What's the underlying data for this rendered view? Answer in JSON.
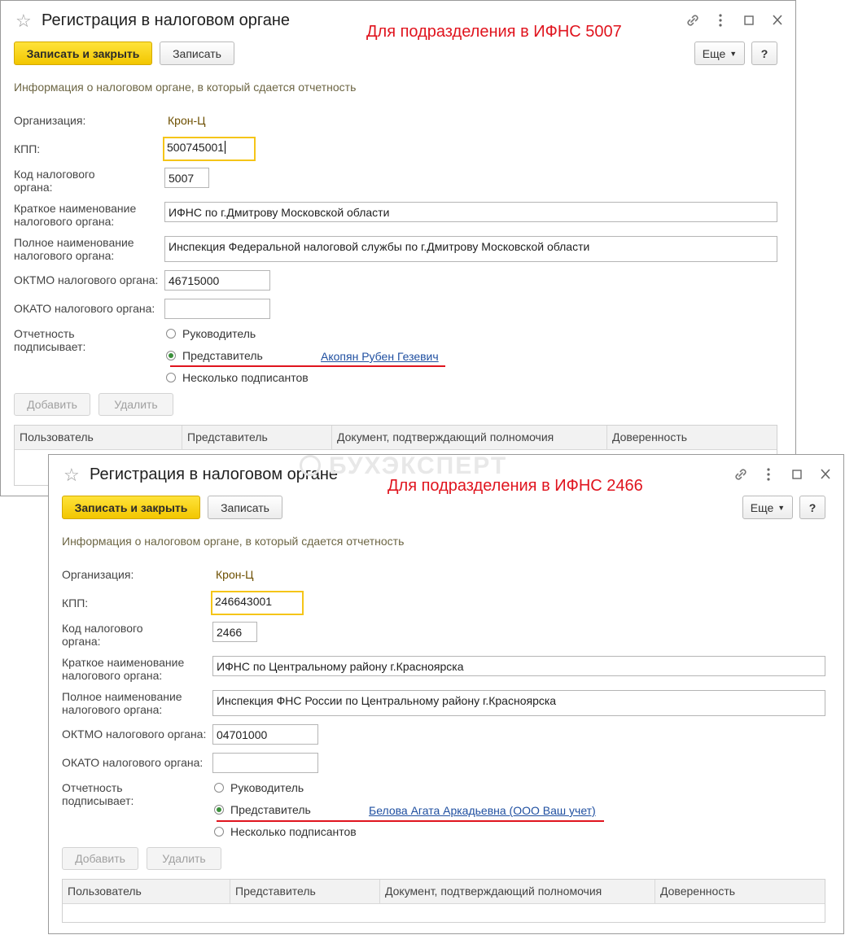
{
  "forms": [
    {
      "title": "Регистрация в налоговом органе",
      "annotation": "Для подразделения в ИФНС 5007",
      "buttons": {
        "save_close": "Записать и закрыть",
        "save": "Записать",
        "more": "Еще",
        "help": "?"
      },
      "hint": "Информация о налоговом органе, в который сдается отчетность",
      "labels": {
        "organization": "Организация:",
        "kpp": "КПП:",
        "code": "Код налогового органа:",
        "short_name": "Краткое наименование налогового органа:",
        "full_name": "Полное наименование налогового органа:",
        "oktmo": "ОКТМО налогового органа:",
        "okato": "ОКАТО налогового органа:",
        "signer": "Отчетность подписывает:"
      },
      "values": {
        "organization": "Крон-Ц",
        "kpp": "500745001",
        "code": "5007",
        "short_name": "ИФНС по г.Дмитрову Московской области",
        "full_name": "Инспекция Федеральной налоговой службы по г.Дмитрову Московской области",
        "oktmo": "46715000",
        "okato": ""
      },
      "signer_options": [
        "Руководитель",
        "Представитель",
        "Несколько подписантов"
      ],
      "signer_selected": "Представитель",
      "representative": "Акопян Рубен Гезевич",
      "table_buttons": {
        "add": "Добавить",
        "delete": "Удалить"
      },
      "table_columns": [
        "Пользователь",
        "Представитель",
        "Документ, подтверждающий полномочия",
        "Доверенность"
      ]
    },
    {
      "title": "Регистрация в налоговом органе",
      "annotation": "Для подразделения в ИФНС 2466",
      "buttons": {
        "save_close": "Записать и закрыть",
        "save": "Записать",
        "more": "Еще",
        "help": "?"
      },
      "hint": "Информация о налоговом органе, в который сдается отчетность",
      "labels": {
        "organization": "Организация:",
        "kpp": "КПП:",
        "code": "Код налогового органа:",
        "short_name": "Краткое наименование налогового органа:",
        "full_name": "Полное наименование налогового органа:",
        "oktmo": "ОКТМО налогового органа:",
        "okato": "ОКАТО налогового органа:",
        "signer": "Отчетность подписывает:"
      },
      "values": {
        "organization": "Крон-Ц",
        "kpp": "246643001",
        "code": "2466",
        "short_name": "ИФНС по Центральному району г.Красноярска",
        "full_name": "Инспекция ФНС России по Центральному району г.Красноярска",
        "oktmo": "04701000",
        "okato": ""
      },
      "signer_options": [
        "Руководитель",
        "Представитель",
        "Несколько подписантов"
      ],
      "signer_selected": "Представитель",
      "representative": "Белова Агата Аркадьевна (ООО Ваш учет)",
      "table_buttons": {
        "add": "Добавить",
        "delete": "Удалить"
      },
      "table_columns": [
        "Пользователь",
        "Представитель",
        "Документ, подтверждающий полномочия",
        "Доверенность"
      ]
    }
  ],
  "watermark": "БУХЭКСПЕРТ",
  "colors": {
    "primary_button": "#f2c600",
    "annotation": "#e0141e",
    "link": "#1f4fa0",
    "focus_border": "#f5c518"
  },
  "icons": [
    "star-icon",
    "link-icon",
    "more-vert-icon",
    "maximize-icon",
    "close-icon",
    "dropdown-arrow-icon"
  ]
}
